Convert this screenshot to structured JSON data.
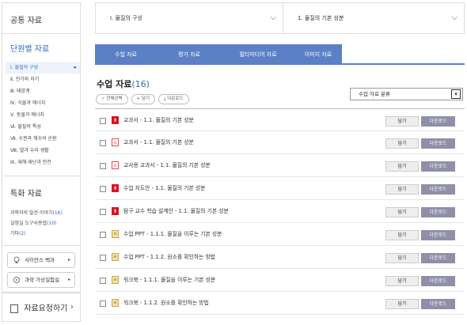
{
  "sidebar": {
    "common": "공통 자료",
    "unit_title": "단원별 자료",
    "units": [
      {
        "label": "Ⅰ. 물질의 구성",
        "active": true
      },
      {
        "label": "Ⅱ. 전기와 자기",
        "active": false
      },
      {
        "label": "Ⅲ. 태양계",
        "active": false
      },
      {
        "label": "Ⅳ. 식물과 에너지",
        "active": false
      },
      {
        "label": "Ⅴ. 동물과 에너지",
        "active": false
      },
      {
        "label": "Ⅵ. 물질의 특성",
        "active": false
      },
      {
        "label": "Ⅶ. 수권과 해수의 순환",
        "active": false
      },
      {
        "label": "Ⅷ. 열과 우리 생활",
        "active": false
      },
      {
        "label": "Ⅸ. 재해·재난과 안전",
        "active": false
      }
    ],
    "special_title": "특화 자료",
    "special": [
      {
        "label": "과학자의 발견 이야기",
        "count": "(16)"
      },
      {
        "label": "실험실 도구사용법",
        "count": "(10)"
      },
      {
        "label": "기타",
        "count": "(2)"
      }
    ],
    "links": [
      {
        "label": "사이언스 백과",
        "icon": "light-bulb-icon"
      },
      {
        "label": "과학 가상실험실",
        "icon": "flask-icon"
      }
    ],
    "request": "자료요청하기"
  },
  "breadcrumb": {
    "level1": "Ⅰ. 물질의 구성",
    "level2": "1. 물질의 기본 성분"
  },
  "tabs": [
    "수업 자료",
    "평가 자료",
    "멀티미디어 자료",
    "이미지 자료"
  ],
  "list_header": {
    "title": "수업 자료",
    "count": "(16)",
    "tools": [
      "전체선택",
      "+ 담기",
      "다운로드"
    ],
    "filter": "수업 자료 분류"
  },
  "items": [
    {
      "title": "교과서 - 1.1. 물질의 기본 성분",
      "icon": "red-doc-icon"
    },
    {
      "title": "교과서 - 1.1. 물질의 기본 성분",
      "icon": "pdf-icon"
    },
    {
      "title": "교사용 교과서 - 1.1. 물질의 기본 성분",
      "icon": "pdf-icon"
    },
    {
      "title": "수업 지도안 - 1.1. 물질의 기본 성분",
      "icon": "red-doc-icon"
    },
    {
      "title": "탐구 교수 학습 설계안 - 1.1. 물질의 기본 성분",
      "icon": "red-doc-icon"
    },
    {
      "title": "수업 PPT - 1.1.1. 물질을 이루는 기본 성분",
      "icon": "ppt-icon"
    },
    {
      "title": "수업 PPT - 1.1.2. 원소를 확인하는 방법",
      "icon": "ppt-icon"
    },
    {
      "title": "워크북 - 1.1.1. 물질을 이루는 기본 성분",
      "icon": "ppt-icon"
    },
    {
      "title": "워크북 - 1.1.2. 원소를 확인하는 방법",
      "icon": "ppt-icon"
    }
  ],
  "row_buttons": {
    "add": "담기",
    "download": "다운로드"
  },
  "colors": {
    "accent": "#5b80c6",
    "link": "#2e6db8",
    "download_btn": "#8f8fa8"
  }
}
